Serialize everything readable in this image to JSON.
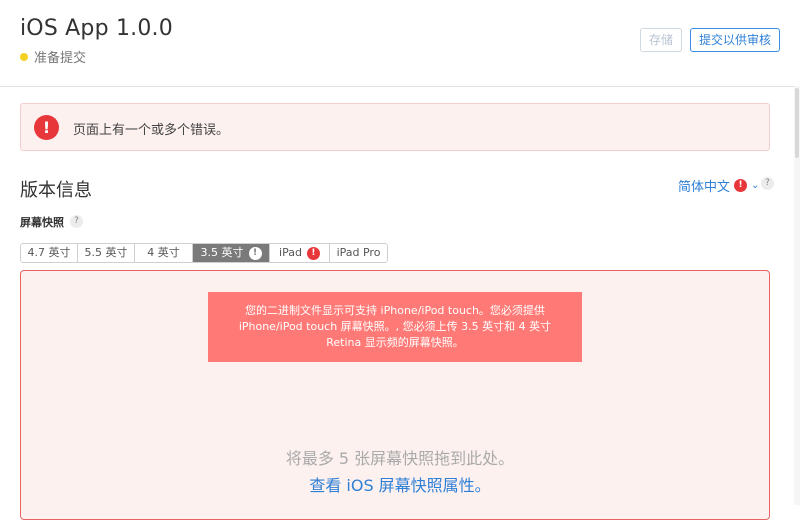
{
  "header": {
    "app_title": "iOS App 1.0.0",
    "status": "准备提交",
    "status_color": "#f5d020",
    "save_label": "存储",
    "submit_label": "提交以供审核"
  },
  "error_banner": {
    "icon": "!",
    "message": "页面上有一个或多个错误。"
  },
  "version_info": {
    "title": "版本信息",
    "language": "简体中文",
    "language_error_icon": "!",
    "help_icon": "?"
  },
  "screenshots": {
    "label": "屏幕快照",
    "help_icon": "?",
    "tabs": [
      {
        "label": "4.7 英寸",
        "active": false,
        "error": false
      },
      {
        "label": "5.5 英寸",
        "active": false,
        "error": false
      },
      {
        "label": "4 英寸",
        "active": false,
        "error": false
      },
      {
        "label": "3.5 英寸",
        "active": true,
        "error": true,
        "badge": "!"
      },
      {
        "label": "iPad",
        "active": false,
        "error": true,
        "badge": "!"
      },
      {
        "label": "iPad Pro",
        "active": false,
        "error": false
      }
    ],
    "tooltip_lines": [
      "您的二进制文件显示可支持 iPhone/iPod touch。您必须提供",
      "iPhone/iPod touch 屏幕快照。, 您必须上传 3.5 英寸和 4 英寸",
      "Retina 显示频的屏幕快照。"
    ],
    "drop_text": "将最多 5 张屏幕快照拖到此处。",
    "drop_link": "查看 iOS 屏幕快照属性。"
  },
  "colors": {
    "accent": "#2e7fd6",
    "error": "#e8373a",
    "tooltip_bg": "#ff7a76",
    "error_bg": "#fdf1f0"
  }
}
